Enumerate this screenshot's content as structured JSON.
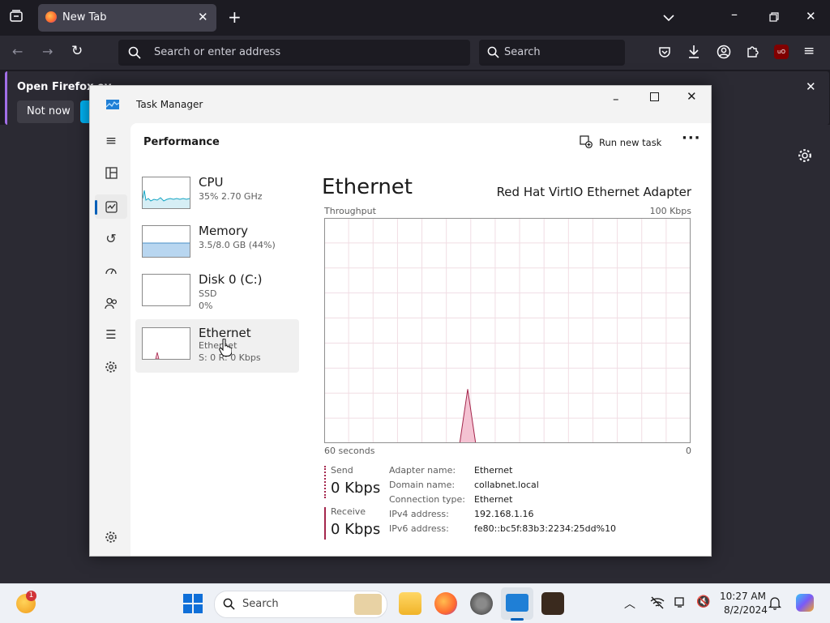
{
  "browser": {
    "tab_title": "New Tab",
    "url_placeholder": "Search or enter address",
    "search_placeholder": "Search",
    "notification_text": "Open Firefox ev",
    "notification_button": "Not now"
  },
  "taskmanager": {
    "window_title": "Task Manager",
    "section_title": "Performance",
    "run_new_task": "Run new task",
    "items": [
      {
        "title": "CPU",
        "sub1": "35%  2.70 GHz",
        "sub2": ""
      },
      {
        "title": "Memory",
        "sub1": "3.5/8.0 GB (44%)",
        "sub2": ""
      },
      {
        "title": "Disk 0 (C:)",
        "sub1": "SSD",
        "sub2": "0%"
      },
      {
        "title": "Ethernet",
        "sub1": "Ethernet",
        "sub2": "S: 0 R: 0 Kbps"
      }
    ],
    "detail": {
      "title": "Ethernet",
      "adapter": "Red Hat VirtIO Ethernet Adapter",
      "throughput_label": "Throughput",
      "max_label": "100 Kbps",
      "time_label": "60 seconds",
      "zero_label": "0",
      "send_label": "Send",
      "send_value": "0 Kbps",
      "receive_label": "Receive",
      "receive_value": "0 Kbps",
      "props": [
        {
          "label": "Adapter name:",
          "value": "Ethernet"
        },
        {
          "label": "Domain name:",
          "value": "collabnet.local"
        },
        {
          "label": "Connection type:",
          "value": "Ethernet"
        },
        {
          "label": "IPv4 address:",
          "value": "192.168.1.16"
        },
        {
          "label": "IPv6 address:",
          "value": "fe80::bc5f:83b3:2234:25dd%10"
        }
      ]
    },
    "chart_data": {
      "type": "area",
      "ylabel": "Throughput",
      "ylim": [
        0,
        100
      ],
      "xlim": [
        60,
        0
      ],
      "x": [
        60,
        50,
        40,
        37.8,
        36.5,
        35.2,
        30,
        20,
        10,
        0
      ],
      "series": [
        {
          "name": "Receive",
          "values": [
            0,
            0,
            0,
            0,
            24,
            0,
            0,
            0,
            0,
            0
          ]
        }
      ]
    }
  },
  "taskbar": {
    "search_label": "Search",
    "time": "10:27 AM",
    "date": "8/2/2024",
    "weather_badge": "1"
  },
  "colors": {
    "accent": "#005fb8",
    "ethernet_line": "#a4264c",
    "ethernet_fill": "#f4c2d2",
    "cpu_line": "#17a6c4",
    "memory_fill": "#b8d6f0"
  }
}
